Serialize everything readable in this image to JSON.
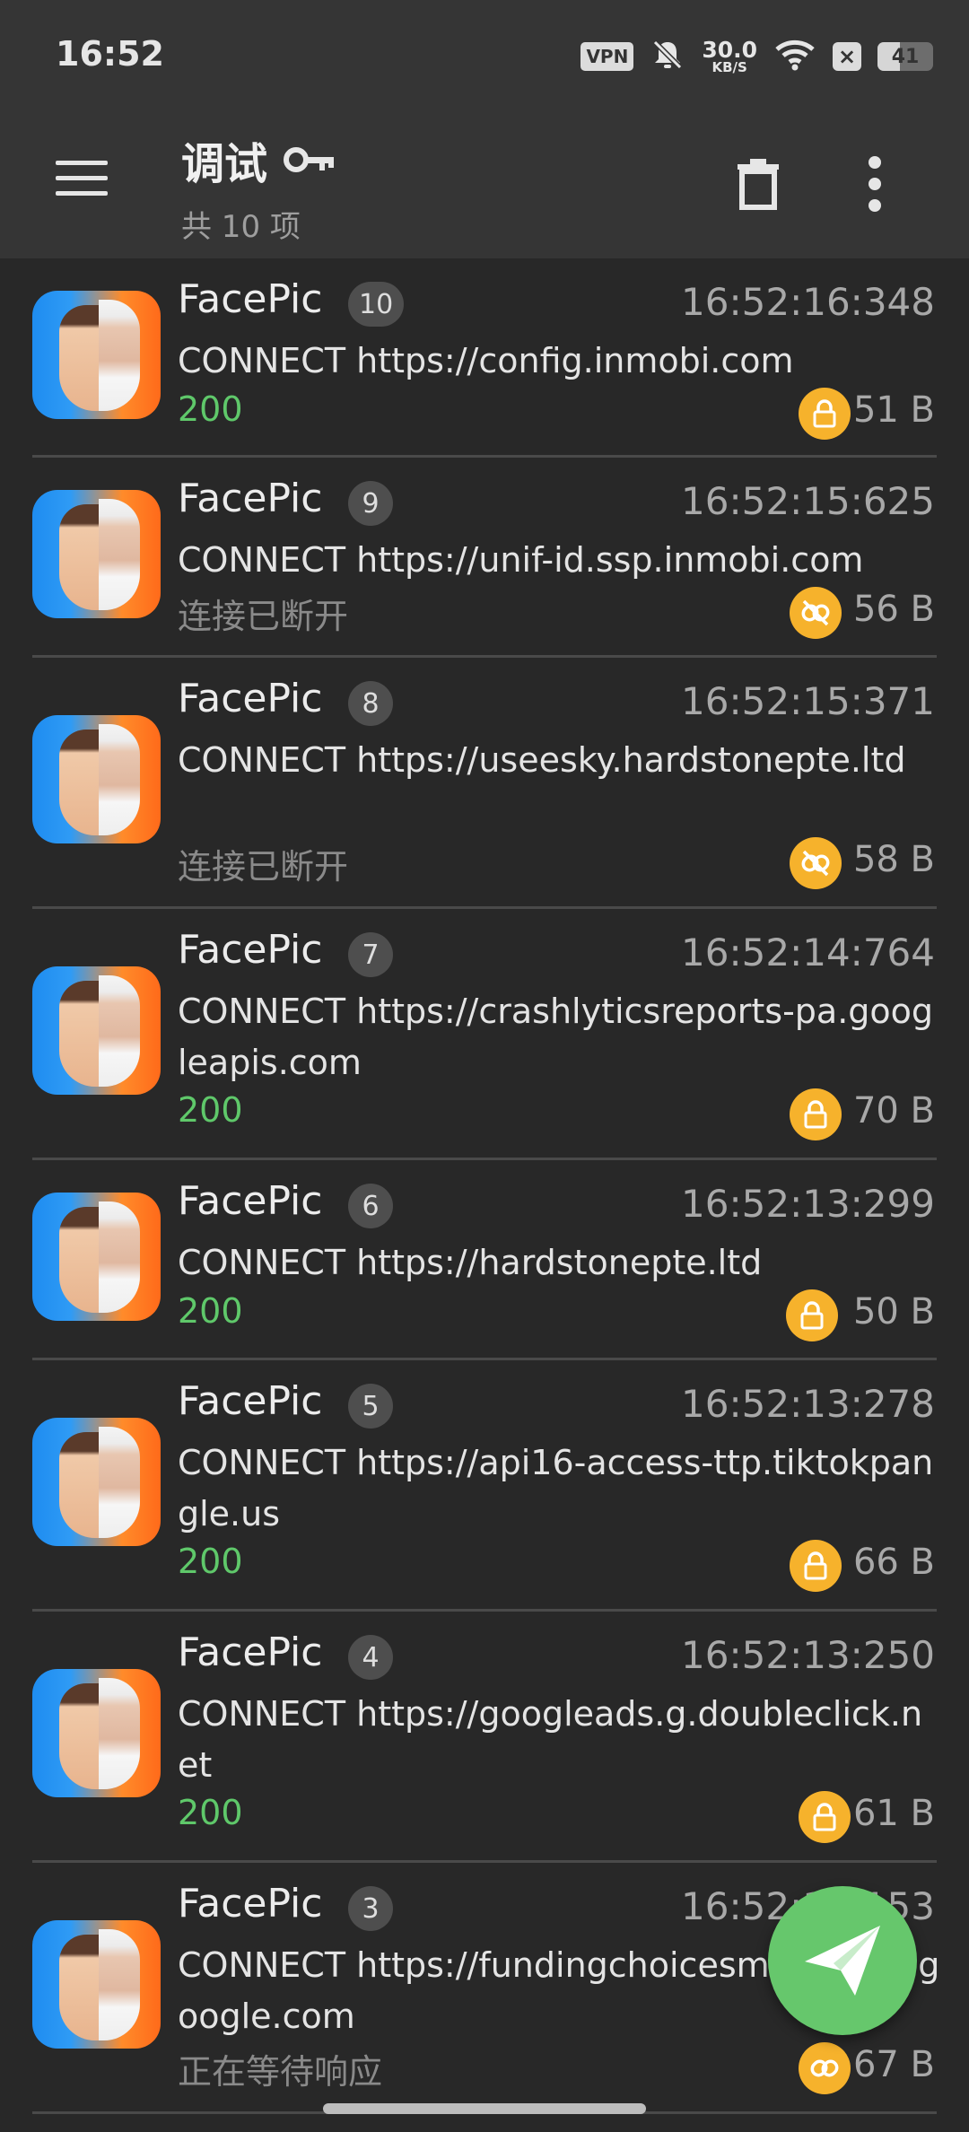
{
  "status_bar": {
    "time": "16:52",
    "vpn": "VPN",
    "speed_value": "30.0",
    "speed_unit": "KB/S",
    "x_badge": "×",
    "battery": "41",
    "battery_level_percent": 41
  },
  "appbar": {
    "title": "调试",
    "subtitle": "共 10 项",
    "icons": [
      "menu-icon",
      "key-icon",
      "trash-icon",
      "more-vert-icon"
    ]
  },
  "requests": [
    {
      "app": "FacePic",
      "index": "10",
      "time": "16:52:16:348",
      "url": "CONNECT https://config.inmobi.com",
      "status": "200",
      "status_type": "ok",
      "security": "lock",
      "size": "51 B"
    },
    {
      "app": "FacePic",
      "index": "9",
      "time": "16:52:15:625",
      "url": "CONNECT https://unif-id.ssp.inmobi.com",
      "status": "连接已断开",
      "status_type": "disconnected",
      "security": "link-off",
      "size": "56 B"
    },
    {
      "app": "FacePic",
      "index": "8",
      "time": "16:52:15:371",
      "url": "CONNECT https://useesky.hardstonepte.ltd",
      "status": "连接已断开",
      "status_type": "disconnected",
      "security": "link-off",
      "size": "58 B"
    },
    {
      "app": "FacePic",
      "index": "7",
      "time": "16:52:14:764",
      "url": "CONNECT https://crashlyticsreports-pa.googleapis.com",
      "status": "200",
      "status_type": "ok",
      "security": "lock",
      "size": "70 B"
    },
    {
      "app": "FacePic",
      "index": "6",
      "time": "16:52:13:299",
      "url": "CONNECT https://hardstonepte.ltd",
      "status": "200",
      "status_type": "ok",
      "security": "lock",
      "size": "50 B"
    },
    {
      "app": "FacePic",
      "index": "5",
      "time": "16:52:13:278",
      "url": "CONNECT https://api16-access-ttp.tiktokpangle.us",
      "status": "200",
      "status_type": "ok",
      "security": "lock",
      "size": "66 B"
    },
    {
      "app": "FacePic",
      "index": "4",
      "time": "16:52:13:250",
      "url": "CONNECT https://googleads.g.doubleclick.net",
      "status": "200",
      "status_type": "ok",
      "security": "lock",
      "size": "61 B"
    },
    {
      "app": "FacePic",
      "index": "3",
      "time": "16:52:13:153",
      "url": "CONNECT https://fundingchoicesmessages.google.com",
      "status": "正在等待响应",
      "status_type": "waiting",
      "security": "link",
      "size": "67 B"
    }
  ],
  "colors": {
    "background": "#282828",
    "appbar": "#353535",
    "status_ok": "#5fc86a",
    "status_dim": "#8a8a8a",
    "lock_badge": "#f6b22c",
    "fab": "#66c76c"
  },
  "fab_icon": "send-icon"
}
